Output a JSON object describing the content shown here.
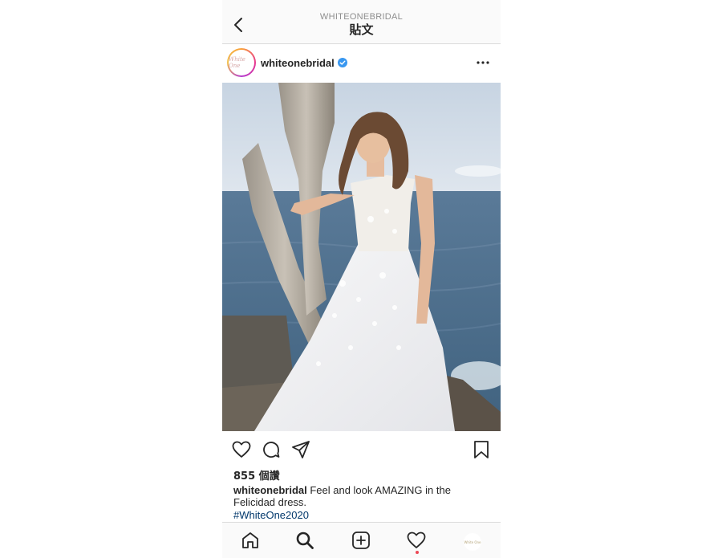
{
  "header": {
    "account": "WHITEONEBRIDAL",
    "title": "貼文"
  },
  "post": {
    "username": "whiteonebridal",
    "avatar_text": "White One",
    "verified": true,
    "likes": "855 個讚",
    "caption_username": "whiteonebridal",
    "caption_text": " Feel and look AMAZING in the Felicidad dress.",
    "hashtag": "#WhiteOne2020"
  },
  "bottom_nav": {
    "profile_text": "White One"
  },
  "icons": {
    "back": "back-arrow-icon",
    "verified": "verified-badge-icon",
    "more": "more-options-icon",
    "like": "heart-icon",
    "comment": "comment-icon",
    "share": "paper-plane-icon",
    "save": "bookmark-icon",
    "home": "home-icon",
    "search": "search-icon",
    "new_post": "plus-square-icon",
    "activity": "heart-icon"
  },
  "colors": {
    "verified_blue": "#3897f0",
    "hashtag_blue": "#00376b",
    "notification_red": "#ed4956",
    "text": "#262626",
    "muted": "#8e8e8e"
  }
}
